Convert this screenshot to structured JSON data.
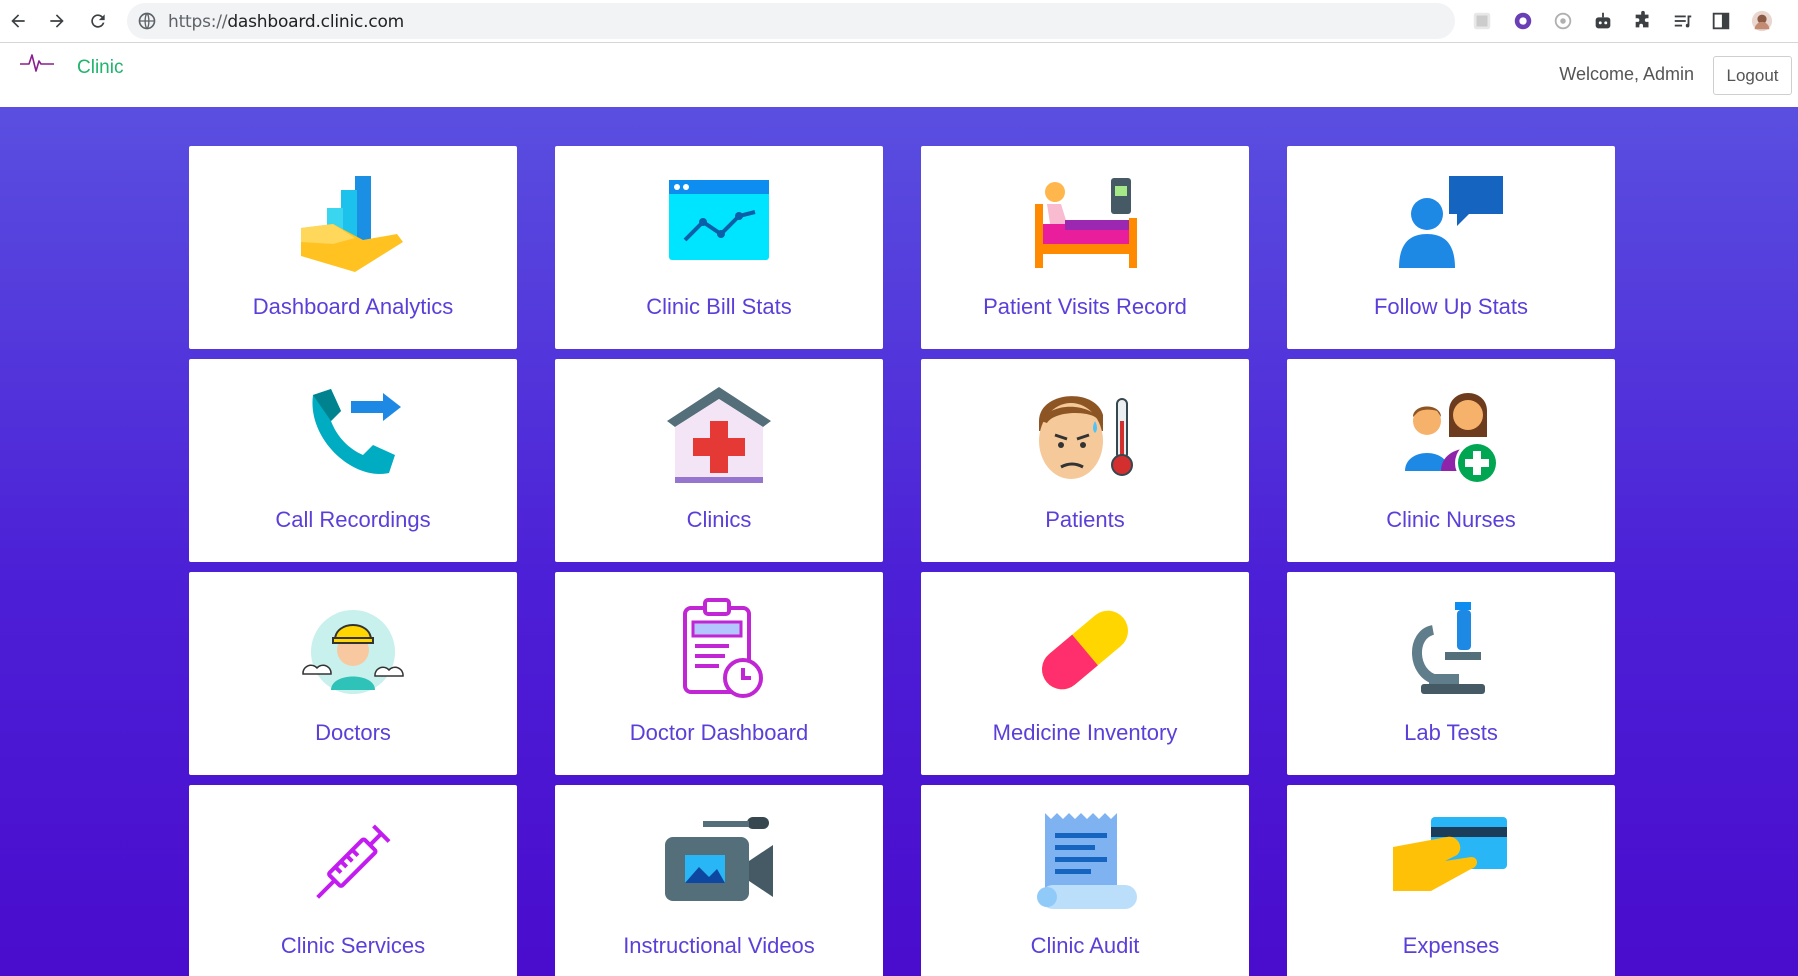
{
  "browser": {
    "url_scheme": "https://",
    "url_host": "dashboard.clinic.com"
  },
  "header": {
    "brand": "Clinic",
    "welcome": "Welcome, Admin",
    "logout_label": "Logout"
  },
  "tiles": [
    {
      "label": "Dashboard Analytics",
      "icon": "analytics-hand-icon"
    },
    {
      "label": "Clinic Bill Stats",
      "icon": "line-chart-window-icon"
    },
    {
      "label": "Patient Visits Record",
      "icon": "patient-bed-icon"
    },
    {
      "label": "Follow Up Stats",
      "icon": "user-chat-icon"
    },
    {
      "label": "Call Recordings",
      "icon": "phone-forward-icon"
    },
    {
      "label": "Clinics",
      "icon": "hospital-cross-icon"
    },
    {
      "label": "Patients",
      "icon": "sick-patient-icon"
    },
    {
      "label": "Clinic Nurses",
      "icon": "nurses-plus-icon"
    },
    {
      "label": "Doctors",
      "icon": "doctor-cap-icon"
    },
    {
      "label": "Doctor Dashboard",
      "icon": "clipboard-clock-icon"
    },
    {
      "label": "Medicine Inventory",
      "icon": "pill-capsule-icon"
    },
    {
      "label": "Lab Tests",
      "icon": "microscope-icon"
    },
    {
      "label": "Clinic Services",
      "icon": "syringe-icon"
    },
    {
      "label": "Instructional Videos",
      "icon": "video-camera-icon"
    },
    {
      "label": "Clinic Audit",
      "icon": "receipt-scroll-icon"
    },
    {
      "label": "Expenses",
      "icon": "hand-card-icon"
    }
  ]
}
